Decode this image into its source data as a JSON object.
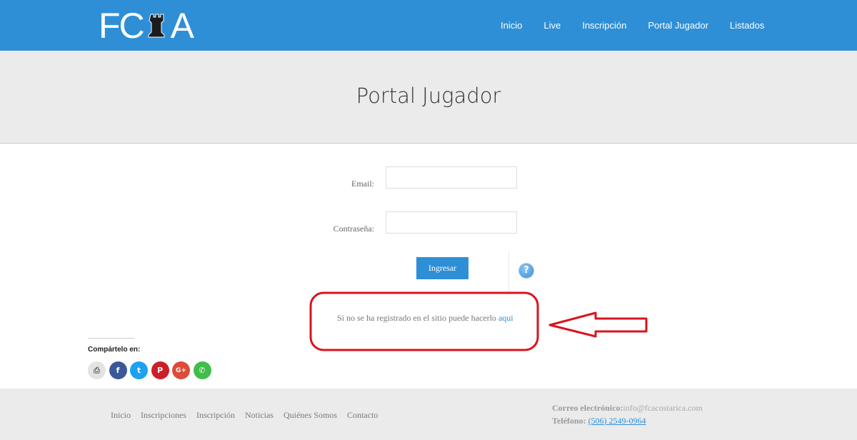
{
  "header": {
    "logo_letters": [
      "F",
      "C",
      "A"
    ],
    "logo_icon": "rook-chess-icon",
    "nav": [
      "Inicio",
      "Live",
      "Inscripción",
      "Portal Jugador",
      "Listados"
    ]
  },
  "title": "Portal Jugador",
  "form": {
    "email_label": "Email:",
    "email_value": "",
    "password_label": "Contraseña:",
    "password_value": "",
    "submit_label": "Ingresar",
    "help_icon": "question-icon",
    "help_glyph": "?"
  },
  "register": {
    "text": "Si no se ha registrado en el sitio puede hacerlo ",
    "link_text": "aqui"
  },
  "share": {
    "label": "Compártelo en:",
    "buttons": [
      {
        "name": "print-icon",
        "glyph": "⎙",
        "color": "#e3e3e3"
      },
      {
        "name": "facebook-icon",
        "glyph": "f",
        "color": "#3b5998"
      },
      {
        "name": "twitter-icon",
        "glyph": "t",
        "color": "#1da1f2"
      },
      {
        "name": "pinterest-icon",
        "glyph": "P",
        "color": "#cb2027"
      },
      {
        "name": "google-plus-icon",
        "glyph": "G+",
        "color": "#dd4b39"
      },
      {
        "name": "whatsapp-icon",
        "glyph": "✆",
        "color": "#3fbd4b"
      }
    ]
  },
  "footer": {
    "links": [
      "Inicio",
      "Inscripciones",
      "Inscripción",
      "Noticias",
      "Quiénes Somos",
      "Contacto"
    ],
    "email_label": "Correo electrónico:",
    "email_value": "info@fcacostarica.com",
    "phone_label": "Teléfono:",
    "phone_value": "(506) 2549-0964"
  },
  "colors": {
    "brand": "#2e8fd6",
    "annotation": "#d9141f"
  }
}
